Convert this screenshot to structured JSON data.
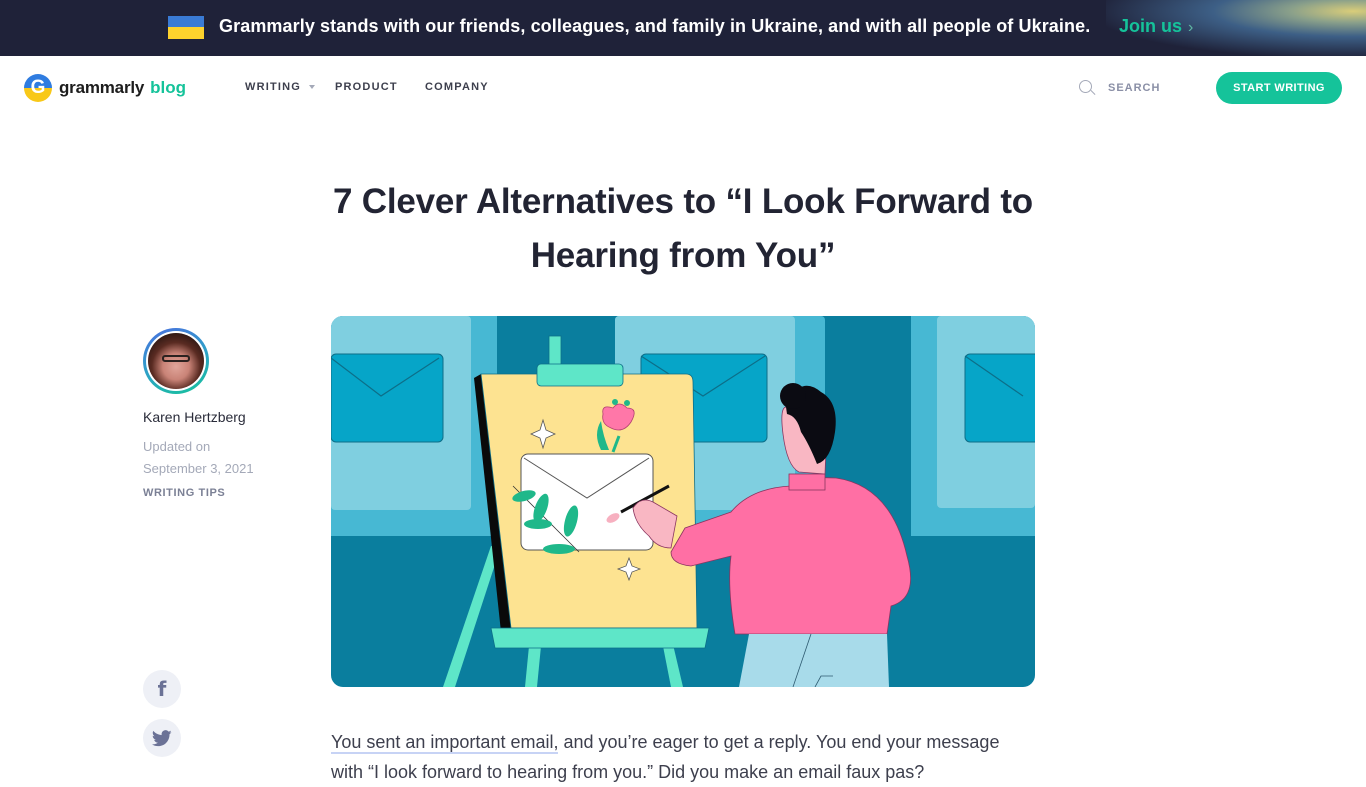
{
  "banner": {
    "text": "Grammarly stands with our friends, colleagues, and family in Ukraine, and with all people of Ukraine.",
    "cta": "Join us",
    "cta_icon": "chevron-right-icon",
    "flag_colors": [
      "#3a7bd5",
      "#fdd22d"
    ]
  },
  "nav": {
    "logo_word": "grammarly",
    "logo_blog": "blog",
    "items": [
      {
        "label": "WRITING",
        "has_dropdown": true
      },
      {
        "label": "PRODUCT",
        "has_dropdown": false
      },
      {
        "label": "COMPANY",
        "has_dropdown": false
      }
    ],
    "search_label": "SEARCH",
    "cta_label": "START WRITING"
  },
  "article": {
    "title": "7 Clever Alternatives to “I Look Forward to Hearing from You”",
    "author": "Karen Hertzberg",
    "updated_label": "Updated on",
    "updated_date": "September 3, 2021",
    "category": "WRITING TIPS",
    "hero_image_alt": "Illustration of a person painting an envelope on an easel",
    "body_link": "You sent an important email,",
    "body_rest": " and you’re eager to get a reply. You end your message with “I look forward to hearing from you.” Did you make an email faux pas?"
  },
  "share": [
    {
      "network": "facebook",
      "icon": "facebook-icon",
      "glyph": "f"
    },
    {
      "network": "twitter",
      "icon": "twitter-icon"
    }
  ],
  "colors": {
    "brand_green": "#15c39a",
    "banner_bg": "#1f2239",
    "title_text": "#222433"
  }
}
